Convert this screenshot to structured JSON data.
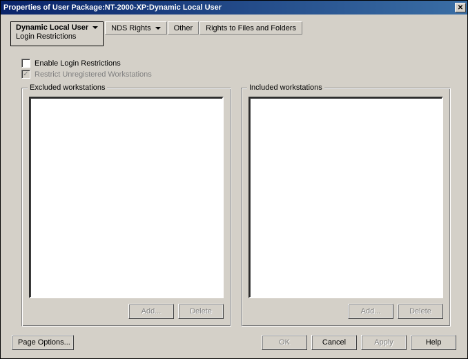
{
  "window": {
    "title": "Properties of User Package:NT-2000-XP:Dynamic Local User"
  },
  "tabs": {
    "active_main": "Dynamic Local User",
    "active_sub": "Login Restrictions",
    "nds": "NDS Rights",
    "other": "Other",
    "rights": "Rights to Files and Folders"
  },
  "checkboxes": {
    "enable_label": "Enable Login Restrictions",
    "enable_checked": false,
    "restrict_label": "Restrict Unregistered Workstations",
    "restrict_checked": true,
    "restrict_enabled": false
  },
  "groups": {
    "excluded_title": "Excluded workstations",
    "included_title": "Included workstations"
  },
  "buttons": {
    "add": "Add...",
    "delete": "Delete",
    "page_options": "Page Options...",
    "ok": "OK",
    "cancel": "Cancel",
    "apply": "Apply",
    "help": "Help"
  }
}
